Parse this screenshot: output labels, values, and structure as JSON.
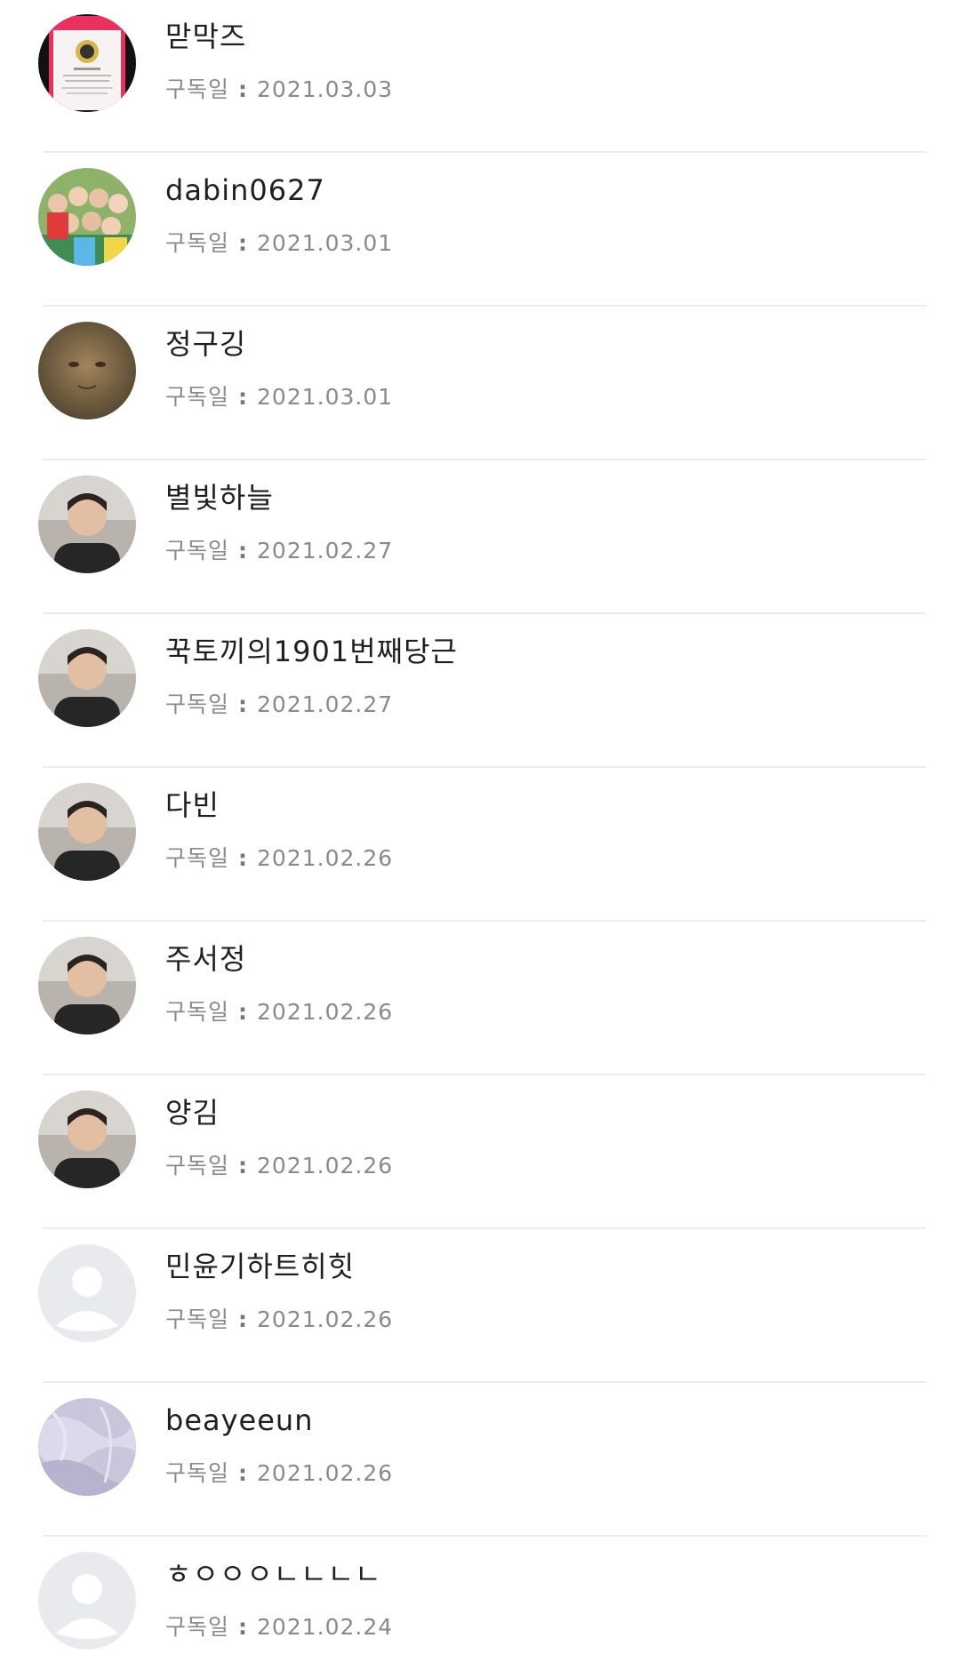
{
  "subscribers": [
    {
      "name": "맏막즈",
      "label": "구독일",
      "sep": ":",
      "date": "2021.03.03",
      "avatar": "certificate-photo"
    },
    {
      "name": "dabin0627",
      "label": "구독일",
      "sep": ":",
      "date": "2021.03.01",
      "avatar": "group-photo"
    },
    {
      "name": "정구깅",
      "label": "구독일",
      "sep": ":",
      "date": "2021.03.01",
      "avatar": "face-photo"
    },
    {
      "name": "별빛하늘",
      "label": "구독일",
      "sep": ":",
      "date": "2021.02.27",
      "avatar": "person-photo"
    },
    {
      "name": "꾹토끼의1901번째당근",
      "label": "구독일",
      "sep": ":",
      "date": "2021.02.27",
      "avatar": "person-photo"
    },
    {
      "name": "다빈",
      "label": "구독일",
      "sep": ":",
      "date": "2021.02.26",
      "avatar": "person-photo"
    },
    {
      "name": "주서정",
      "label": "구독일",
      "sep": ":",
      "date": "2021.02.26",
      "avatar": "person-photo"
    },
    {
      "name": "양김",
      "label": "구독일",
      "sep": ":",
      "date": "2021.02.26",
      "avatar": "person-photo"
    },
    {
      "name": "민윤기하트히힛",
      "label": "구독일",
      "sep": ":",
      "date": "2021.02.26",
      "avatar": "default-avatar"
    },
    {
      "name": "beayeeun",
      "label": "구독일",
      "sep": ":",
      "date": "2021.02.26",
      "avatar": "texture-photo"
    },
    {
      "name": "ㅎㅇㅇㅇㄴㄴㄴㄴ",
      "label": "구독일",
      "sep": ":",
      "date": "2021.02.24",
      "avatar": "default-avatar"
    }
  ],
  "colors": {
    "divider": "#ececec",
    "name_text": "#1f1f1f",
    "meta_text": "#8a8a8a",
    "default_avatar_bg": "#e8eaee",
    "default_avatar_fg": "#ffffff"
  }
}
